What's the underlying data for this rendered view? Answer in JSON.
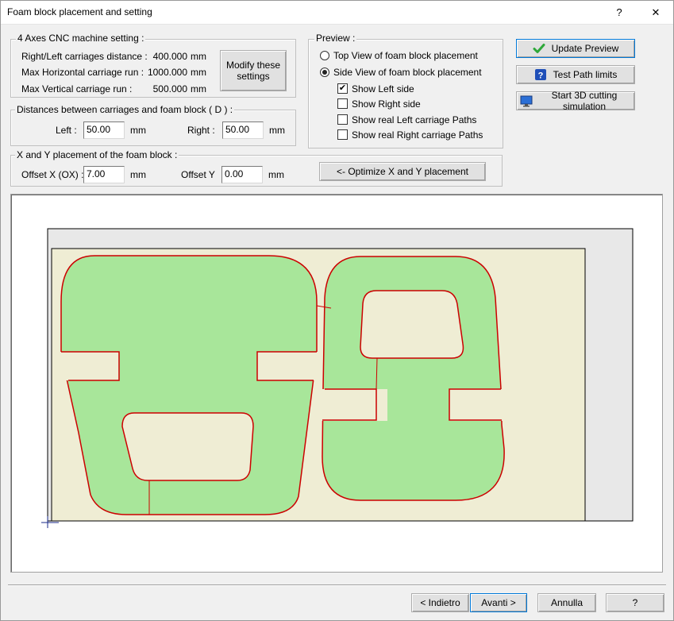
{
  "window": {
    "title": "Foam block placement and setting",
    "help_glyph": "?",
    "close_glyph": "✕"
  },
  "machine": {
    "legend": "4 Axes CNC machine setting :",
    "rows": [
      {
        "label": "Right/Left carriages distance :",
        "value": "400.000",
        "unit": "mm"
      },
      {
        "label": "Max Horizontal carriage run :",
        "value": "1000.000",
        "unit": "mm"
      },
      {
        "label": "Max Vertical carriage run :",
        "value": "500.000",
        "unit": "mm"
      }
    ],
    "modify_button": "Modify these\nsettings"
  },
  "distances": {
    "legend": "Distances between carriages and foam block   ( D ) :",
    "left_label": "Left :",
    "left_value": "50.00",
    "left_unit": "mm",
    "right_label": "Right :",
    "right_value": "50.00",
    "right_unit": "mm"
  },
  "placement": {
    "legend": "X and Y placement of the  foam block :",
    "offset_x_label": "Offset X (OX) :",
    "offset_x_value": "7.00",
    "offset_x_unit": "mm",
    "offset_y_label": "Offset Y",
    "offset_y_value": "0.00",
    "offset_y_unit": "mm",
    "optimize_button": "<- Optimize X and Y placement"
  },
  "preview": {
    "legend": "Preview :",
    "options": [
      {
        "label": "Top View of foam block placement",
        "selected": false
      },
      {
        "label": "Side View of foam block placement",
        "selected": true
      }
    ],
    "checks": [
      {
        "label": "Show Left side",
        "checked": true
      },
      {
        "label": "Show Right side",
        "checked": false
      },
      {
        "label": "Show real Left carriage Paths",
        "checked": false
      },
      {
        "label": "Show real Right carriage Paths",
        "checked": false
      }
    ]
  },
  "actions": {
    "update_preview": "Update Preview",
    "test_path_limits": "Test Path limits",
    "start_simulation": "Start 3D cutting simulation"
  },
  "footer": {
    "back": "< Indietro",
    "next": "Avanti >",
    "cancel": "Annulla",
    "help": "?"
  },
  "colors": {
    "foam_block": "#efedd4",
    "shape_fill": "#a8e69a",
    "shape_stroke": "#cc0000",
    "machine_area": "#e8e8e8",
    "check_green": "#2fa83a",
    "help_blue": "#1f4fb8"
  }
}
